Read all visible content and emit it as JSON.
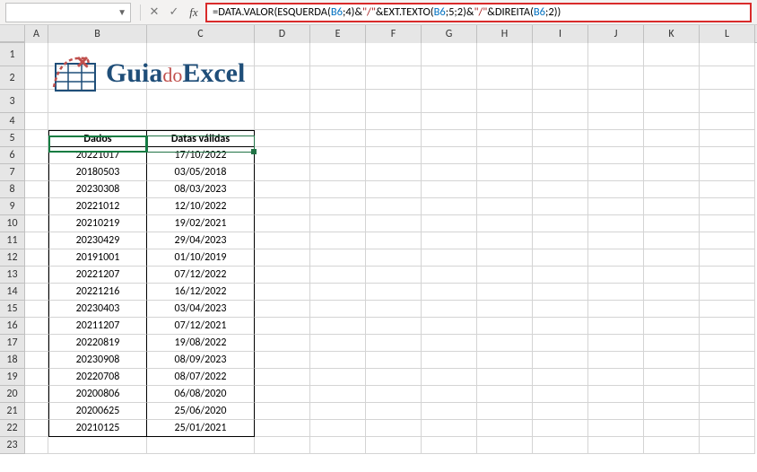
{
  "formula_bar": {
    "cell_ref": "",
    "formula_tokens": [
      {
        "t": "=",
        "c": "tk-op"
      },
      {
        "t": "DATA.VALOR",
        "c": "tk-fn"
      },
      {
        "t": "(",
        "c": "tk-op"
      },
      {
        "t": "ESQUERDA",
        "c": "tk-fn"
      },
      {
        "t": "(",
        "c": "tk-op"
      },
      {
        "t": "B6",
        "c": "tk-ref"
      },
      {
        "t": ";",
        "c": "tk-op"
      },
      {
        "t": "4",
        "c": "tk-num"
      },
      {
        "t": ")",
        "c": "tk-op"
      },
      {
        "t": "&",
        "c": "tk-op"
      },
      {
        "t": "\"/\"",
        "c": "tk-str"
      },
      {
        "t": "&",
        "c": "tk-op"
      },
      {
        "t": "EXT.TEXTO",
        "c": "tk-fn"
      },
      {
        "t": "(",
        "c": "tk-op"
      },
      {
        "t": "B6",
        "c": "tk-ref"
      },
      {
        "t": ";",
        "c": "tk-op"
      },
      {
        "t": "5",
        "c": "tk-num"
      },
      {
        "t": ";",
        "c": "tk-op"
      },
      {
        "t": "2",
        "c": "tk-num"
      },
      {
        "t": ")",
        "c": "tk-op"
      },
      {
        "t": "&",
        "c": "tk-op"
      },
      {
        "t": "\"/\"",
        "c": "tk-str"
      },
      {
        "t": "&",
        "c": "tk-op"
      },
      {
        "t": "DIREITA",
        "c": "tk-fn"
      },
      {
        "t": "(",
        "c": "tk-op"
      },
      {
        "t": "B6",
        "c": "tk-ref"
      },
      {
        "t": ";",
        "c": "tk-op"
      },
      {
        "t": "2",
        "c": "tk-num"
      },
      {
        "t": ")",
        "c": "tk-op"
      },
      {
        "t": ")",
        "c": "tk-op"
      }
    ]
  },
  "logo": {
    "guia": "Guia",
    "do": "do",
    "excel": "Excel"
  },
  "columns": [
    "A",
    "B",
    "C",
    "D",
    "E",
    "F",
    "G",
    "H",
    "I",
    "J",
    "K",
    "L"
  ],
  "headers": {
    "b": "Dados",
    "c": "Datas válidas"
  },
  "rows": [
    {
      "n": 1
    },
    {
      "n": 2
    },
    {
      "n": 3
    },
    {
      "n": 4
    },
    {
      "n": 5,
      "header": true
    },
    {
      "n": 6,
      "b": "20221017",
      "c": "17/10/2022"
    },
    {
      "n": 7,
      "b": "20180503",
      "c": "03/05/2018"
    },
    {
      "n": 8,
      "b": "20230308",
      "c": "08/03/2023"
    },
    {
      "n": 9,
      "b": "20221012",
      "c": "12/10/2022"
    },
    {
      "n": 10,
      "b": "20210219",
      "c": "19/02/2021"
    },
    {
      "n": 11,
      "b": "20230429",
      "c": "29/04/2023"
    },
    {
      "n": 12,
      "b": "20191001",
      "c": "01/10/2019"
    },
    {
      "n": 13,
      "b": "20221207",
      "c": "07/12/2022"
    },
    {
      "n": 14,
      "b": "20221216",
      "c": "16/12/2022"
    },
    {
      "n": 15,
      "b": "20230403",
      "c": "03/04/2023"
    },
    {
      "n": 16,
      "b": "20211207",
      "c": "07/12/2021"
    },
    {
      "n": 17,
      "b": "20220819",
      "c": "19/08/2022"
    },
    {
      "n": 18,
      "b": "20230908",
      "c": "08/09/2023"
    },
    {
      "n": 19,
      "b": "20220708",
      "c": "08/07/2022"
    },
    {
      "n": 20,
      "b": "20200806",
      "c": "06/08/2020"
    },
    {
      "n": 21,
      "b": "20200625",
      "c": "25/06/2020"
    },
    {
      "n": 22,
      "b": "20210125",
      "c": "25/01/2021"
    },
    {
      "n": 23
    }
  ]
}
